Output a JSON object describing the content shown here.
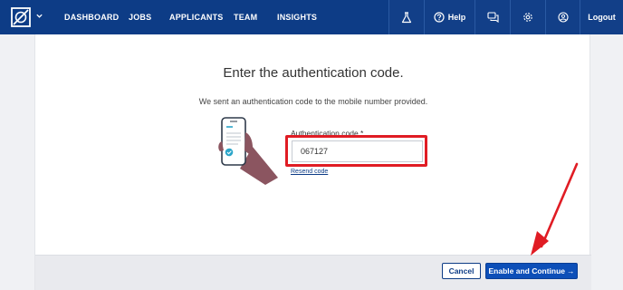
{
  "nav": {
    "links": [
      "DASHBOARD",
      "JOBS",
      "APPLICANTS",
      "TEAM",
      "INSIGHTS"
    ],
    "help_label": "Help",
    "logout_label": "Logout"
  },
  "auth": {
    "heading": "Enter the authentication code.",
    "description": "We sent an authentication code to the mobile number provided.",
    "field_label": "Authentication code *",
    "code_value": "067127",
    "resend_label": "Resend code"
  },
  "footer": {
    "cancel_label": "Cancel",
    "enable_label": "Enable and Continue",
    "enable_arrow": "→"
  },
  "colors": {
    "nav_bg": "#0d3c86",
    "primary_button": "#0d4fb8",
    "annotation_red": "#e01c24",
    "footer_bg": "#e9eaee"
  },
  "icons": [
    "logo-icon",
    "chevron-down-icon",
    "flask-icon",
    "help-icon",
    "chat-icon",
    "gear-icon",
    "user-icon",
    "phone-check-icon",
    "arrow-right-icon"
  ]
}
